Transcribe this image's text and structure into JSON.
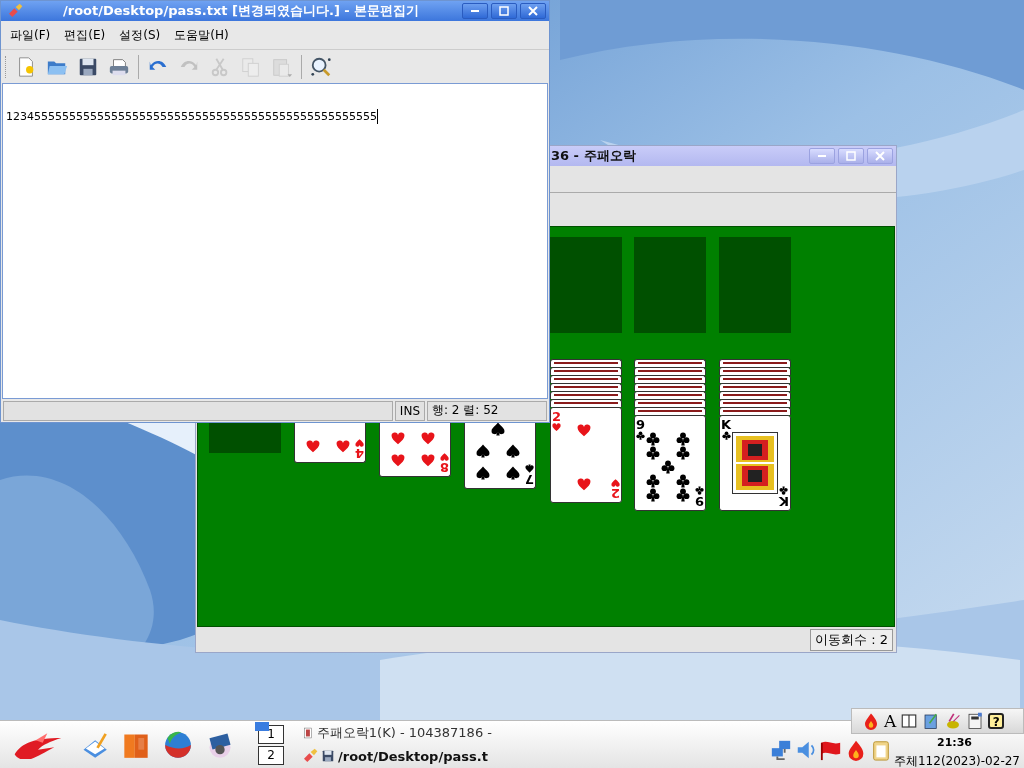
{
  "editor": {
    "title": "/root/Desktop/pass.txt [변경되였습니다.] - 본문편집기",
    "menu": [
      "파일(F)",
      "편집(E)",
      "설정(S)",
      "도움말(H)"
    ],
    "toolbar": [
      {
        "kind": "new",
        "disabled": false
      },
      {
        "kind": "open",
        "disabled": false
      },
      {
        "kind": "save",
        "disabled": false
      },
      {
        "kind": "print",
        "disabled": false
      },
      {
        "kind": "separator"
      },
      {
        "kind": "undo",
        "disabled": false
      },
      {
        "kind": "redo",
        "disabled": true
      },
      {
        "kind": "cut",
        "disabled": true
      },
      {
        "kind": "copy",
        "disabled": true
      },
      {
        "kind": "paste",
        "disabled": true
      },
      {
        "kind": "separator"
      },
      {
        "kind": "find",
        "disabled": false
      }
    ],
    "text": "12345555555555555555555555555555555555555555555555555",
    "status": {
      "mode": "INS",
      "position": "행: 2 렬: 52"
    }
  },
  "solitaire": {
    "title": "36 - 주패오락",
    "columns": [
      {
        "cards": [
          {
            "kind": "hearts",
            "bottom_index": "4",
            "pip_rows": [
              {
                "kind": "pair"
              }
            ]
          }
        ]
      },
      {
        "cards": [
          {
            "kind": "hearts",
            "bottom_index": "8",
            "pip_rows": [
              {
                "kind": "pair"
              },
              {
                "kind": "pair"
              }
            ]
          }
        ]
      },
      {
        "cards": [
          {
            "kind": "spades",
            "bottom_index": "7",
            "pip_rows": [
              {
                "kind": "single"
              },
              {
                "kind": "pair"
              },
              {
                "kind": "pair"
              }
            ]
          }
        ]
      },
      {
        "cards": [
          {
            "kind": "back"
          },
          {
            "kind": "back"
          },
          {
            "kind": "back"
          },
          {
            "kind": "back"
          },
          {
            "kind": "back"
          },
          {
            "kind": "back"
          },
          {
            "kind": "hearts",
            "top_index": "2",
            "bottom_index": "2",
            "pip_rows": [
              {
                "kind": "single"
              },
              {
                "kind": "single"
              }
            ]
          }
        ]
      },
      {
        "cards": [
          {
            "kind": "back"
          },
          {
            "kind": "back"
          },
          {
            "kind": "back"
          },
          {
            "kind": "back"
          },
          {
            "kind": "back"
          },
          {
            "kind": "back"
          },
          {
            "kind": "back"
          },
          {
            "kind": "clubs",
            "top_index": "9",
            "bottom_index": "9",
            "pip_rows": [
              {
                "kind": "pair"
              },
              {
                "kind": "pair"
              },
              {
                "kind": "single"
              },
              {
                "kind": "pair"
              },
              {
                "kind": "pair"
              }
            ]
          }
        ]
      },
      {
        "cards": [
          {
            "kind": "back"
          },
          {
            "kind": "back"
          },
          {
            "kind": "back"
          },
          {
            "kind": "back"
          },
          {
            "kind": "back"
          },
          {
            "kind": "back"
          },
          {
            "kind": "back"
          },
          {
            "kind": "clubs",
            "top_index": "K",
            "bottom_index": "K",
            "court": true
          }
        ]
      }
    ],
    "status": "이동회수 : 2"
  },
  "taskbar": {
    "launchers": [
      {
        "kind": "logo"
      },
      {
        "kind": "notepad"
      },
      {
        "kind": "books"
      },
      {
        "kind": "globe"
      },
      {
        "kind": "film"
      }
    ],
    "desktops": [
      {
        "label": "1",
        "selected": true
      },
      {
        "label": "2",
        "selected": false
      }
    ],
    "tasks": [
      {
        "kind": "cards",
        "label": "주패오락1(K) - 104387186 -",
        "selected": false
      },
      {
        "kind": "editor",
        "label": "/root/Desktop/pass.t",
        "selected": true
      }
    ],
    "input_toolbar": [
      {
        "kind": "flame"
      },
      {
        "kind": "font",
        "label": "A"
      },
      {
        "kind": "layout"
      },
      {
        "kind": "notebook"
      },
      {
        "kind": "paint"
      },
      {
        "kind": "calc"
      },
      {
        "kind": "help",
        "label": "?"
      }
    ],
    "tray": [
      {
        "kind": "network"
      },
      {
        "kind": "volume"
      },
      {
        "kind": "flag"
      },
      {
        "kind": "flame"
      },
      {
        "kind": "clipboard"
      }
    ],
    "clock": "21:36",
    "date": "주체112(2023)-02-27"
  }
}
